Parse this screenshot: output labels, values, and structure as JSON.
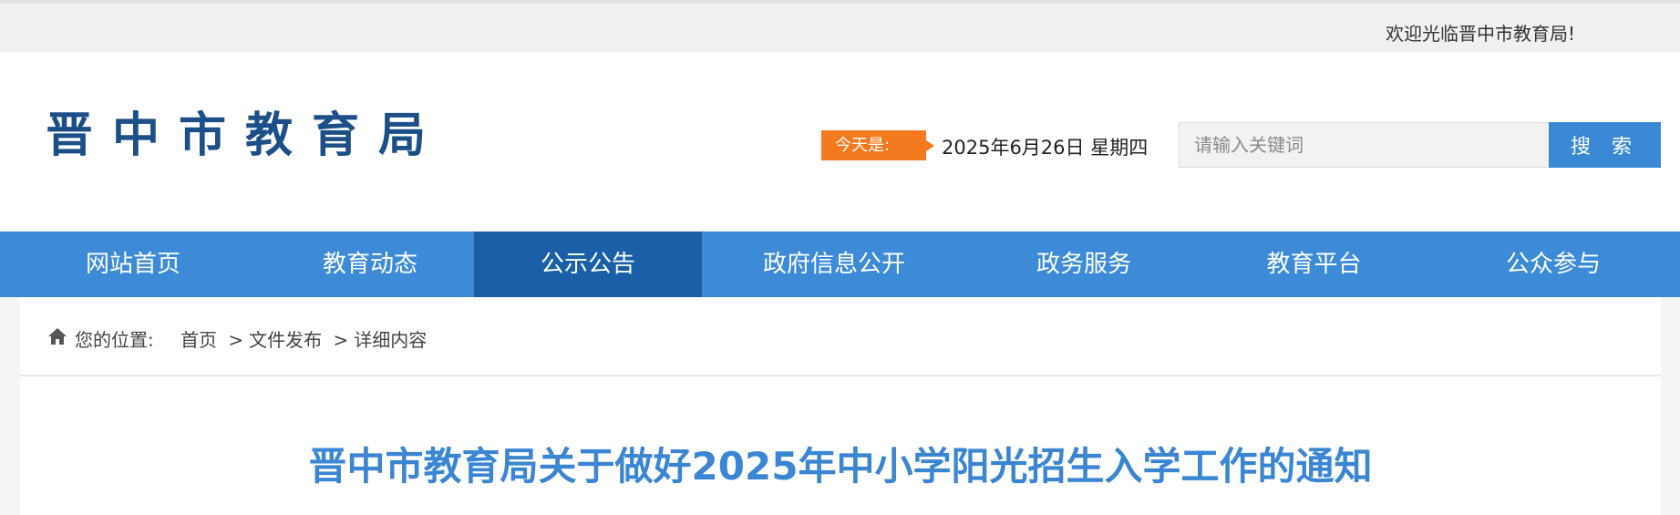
{
  "topbar": {
    "welcome": "欢迎光临晋中市教育局!"
  },
  "header": {
    "logo": "晋中市教育局",
    "date_label": "今天是:",
    "date_value": "2025年6月26日 星期四",
    "search": {
      "placeholder": "请输入关键词",
      "value": "",
      "button_label": "搜 索"
    }
  },
  "nav": {
    "items": [
      {
        "label": "网站首页"
      },
      {
        "label": "教育动态"
      },
      {
        "label": "公示公告"
      },
      {
        "label": "政府信息公开"
      },
      {
        "label": "政务服务"
      },
      {
        "label": "教育平台"
      },
      {
        "label": "公众参与"
      }
    ],
    "active_index": 2
  },
  "breadcrumb": {
    "icon": "home-icon",
    "label": "您的位置:",
    "items": [
      "首页",
      "文件发布",
      "详细内容"
    ],
    "separator": ">"
  },
  "article": {
    "title": "晋中市教育局关于做好2025年中小学阳光招生入学工作的通知"
  },
  "colors": {
    "nav_bg": "#3d8ad7",
    "nav_active": "#1a5fa8",
    "logo": "#1c4f88",
    "date_label_bg": "#f47a20",
    "title": "#3b86d2",
    "search_button": "#3a87d4"
  }
}
